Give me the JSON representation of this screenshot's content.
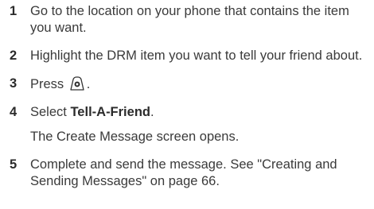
{
  "steps": [
    {
      "num": "1",
      "text": "Go to the location on your phone that contains the item you want."
    },
    {
      "num": "2",
      "text": "Highlight the DRM item you want to tell your friend about."
    },
    {
      "num": "3",
      "before": "Press ",
      "after": ".",
      "icon": "menu-key-icon"
    },
    {
      "num": "4",
      "before": "Select ",
      "bold": "Tell-A-Friend",
      "after": "."
    },
    {
      "num": "5",
      "text": "Complete and send the message. See \"Creating and Sending Messages\" on page 66."
    }
  ],
  "note_after_step4": "The Create Message screen opens."
}
